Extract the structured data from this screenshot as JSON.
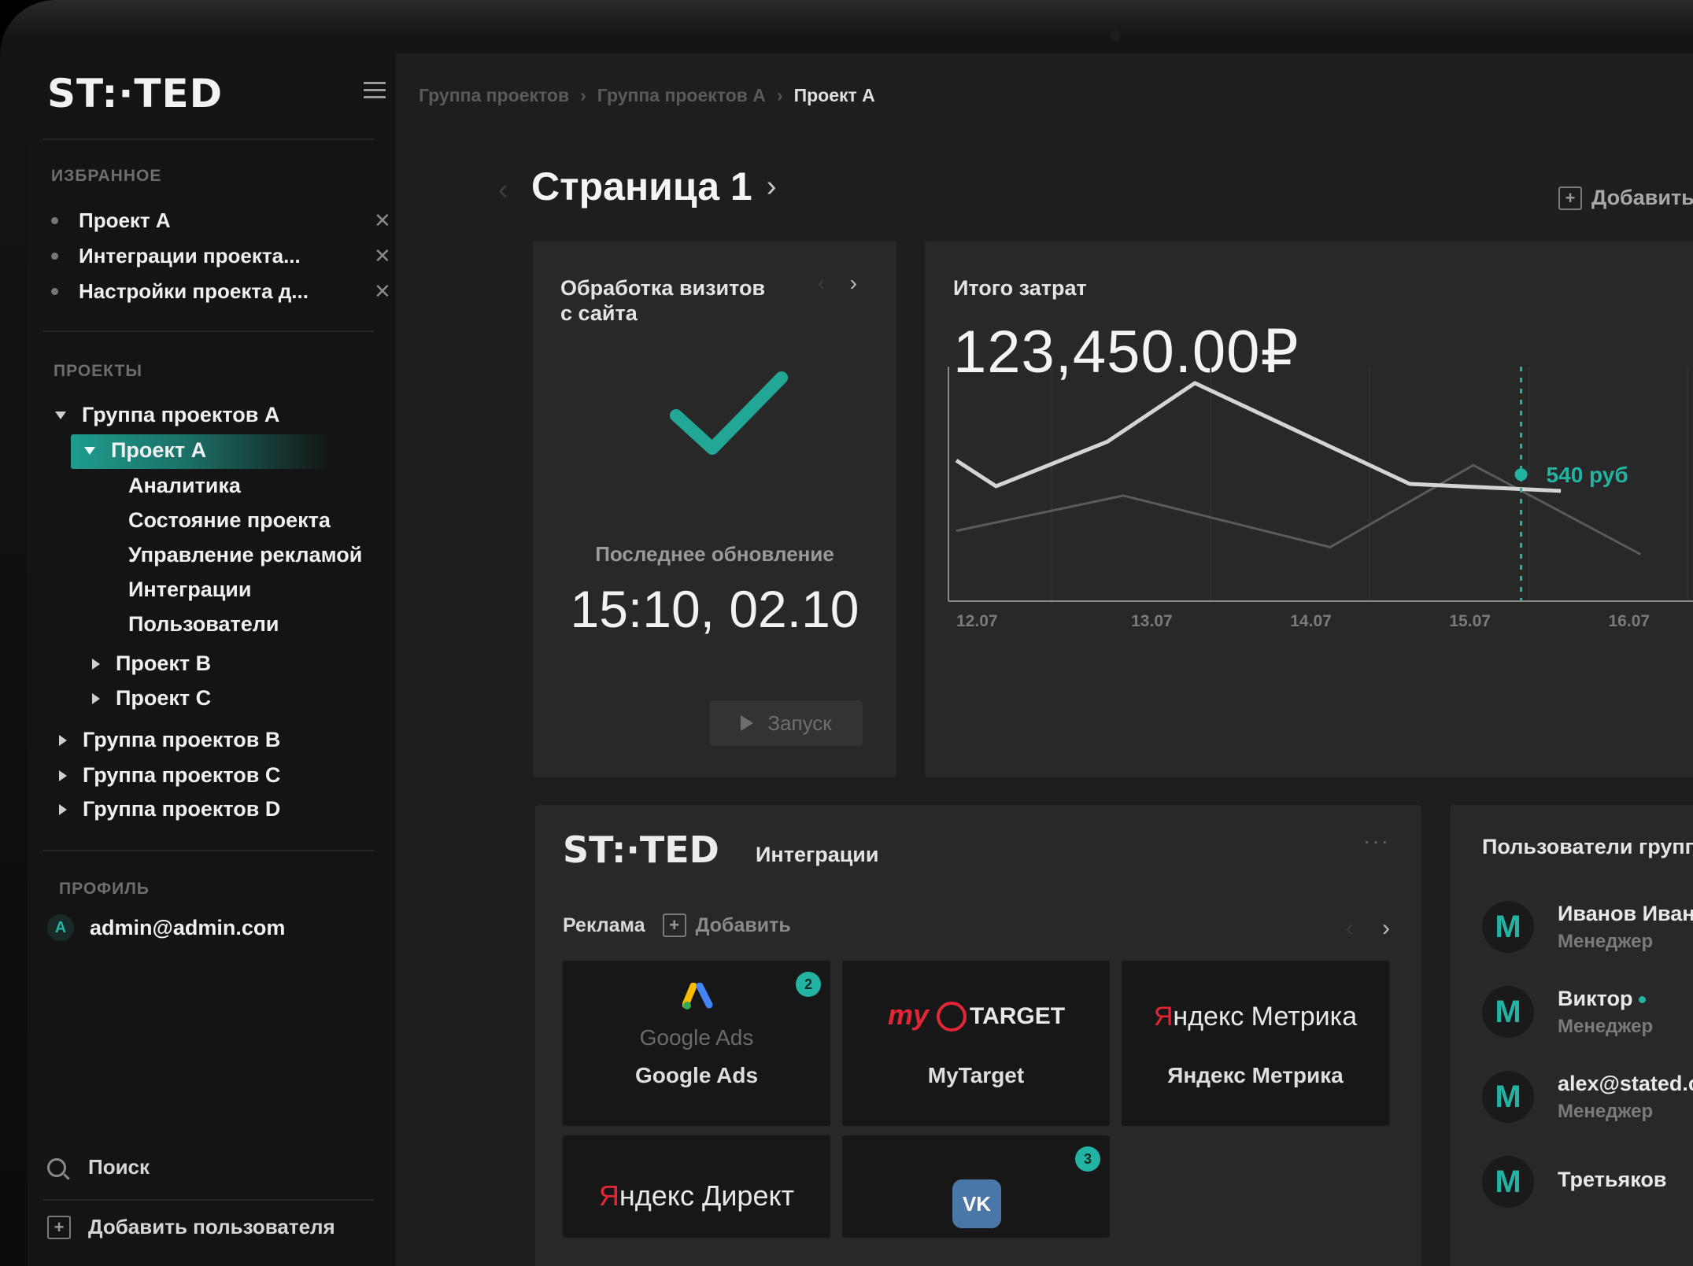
{
  "sidebar": {
    "logo": "ST:·TED",
    "favorites_title": "ИЗБРАННОЕ",
    "favorites": [
      "Проект А",
      "Интеграции проекта...",
      "Настройки проекта д..."
    ],
    "projects_title": "ПРОЕКТЫ",
    "tree": {
      "group_a": "Группа проектов А",
      "project_a": "Проект А",
      "project_a_children": [
        "Аналитика",
        "Состояние проекта",
        "Управление рекламой",
        "Интеграции",
        "Пользователи"
      ],
      "project_b": "Проект В",
      "project_c": "Проект С",
      "group_b": "Группа проектов В",
      "group_c": "Группа проектов С",
      "group_d": "Группа проектов D"
    },
    "profile_title": "ПРОФИЛЬ",
    "profile_avatar": "A",
    "profile_email": "admin@admin.com",
    "search_label": "Поиск",
    "add_user_label": "Добавить пользователя"
  },
  "breadcrumb": [
    "Группа проектов",
    "Группа проектов А",
    "Проект А"
  ],
  "page": {
    "title": "Страница 1",
    "add_label": "Добавить"
  },
  "visits_card": {
    "title_line1": "Обработка визитов",
    "title_line2": "с сайта",
    "last_update_label": "Последнее обновление",
    "last_update_value": "15:10, 02.10",
    "run_label": "Запуск"
  },
  "costs_card": {
    "title": "Итого затрат",
    "total": "123,450.00₽",
    "tooltip": "540 руб"
  },
  "chart_data": {
    "type": "line",
    "categories": [
      "12.07",
      "13.07",
      "14.07",
      "15.07",
      "16.07"
    ],
    "series": [
      {
        "name": "",
        "points": [
          [
            0.0,
            600
          ],
          [
            0.25,
            490
          ],
          [
            0.95,
            680
          ],
          [
            1.5,
            930
          ],
          [
            2.85,
            500
          ],
          [
            3.8,
            470
          ]
        ]
      },
      {
        "name": "",
        "points": [
          [
            0.0,
            300
          ],
          [
            1.05,
            450
          ],
          [
            2.35,
            230
          ],
          [
            3.25,
            580
          ],
          [
            4.3,
            200
          ]
        ]
      }
    ],
    "highlight": {
      "x": 3.55,
      "value": 540,
      "label": "540 руб"
    },
    "ylim": [
      0,
      1000
    ],
    "xlim": [
      0,
      4.7
    ],
    "grid": true,
    "line_colors": [
      "#d4d4d4",
      "#5a5a5a"
    ],
    "accent": "#22b3a3"
  },
  "integrations": {
    "logo": "ST:·TED",
    "title": "Интеграции",
    "more": "···",
    "section": "Реклама",
    "add_label": "Добавить",
    "tiles": [
      {
        "name": "Google Ads",
        "brand": "Google Ads",
        "badge": "2"
      },
      {
        "name": "MyTarget",
        "brand_left": "my",
        "brand_right": "TARGET",
        "badge": ""
      },
      {
        "name": "Яндекс Метрика",
        "brand_left": "Я",
        "brand_right": "ндекс Метрика",
        "badge": ""
      },
      {
        "name": "",
        "brand_left": "Я",
        "brand_right": "ндекс Директ",
        "badge": ""
      },
      {
        "name": "",
        "brand": "VK",
        "badge": "3"
      }
    ]
  },
  "users": {
    "title": "Пользователи групп",
    "list": [
      {
        "avatar": "M",
        "name": "Иванов Иван",
        "role": "Менеджер"
      },
      {
        "avatar": "M",
        "name": "Виктор",
        "role": "Менеджер"
      },
      {
        "avatar": "M",
        "name": "alex@stated.c",
        "role": "Менеджер"
      },
      {
        "avatar": "M",
        "name": "Третьяков",
        "role": ""
      }
    ]
  },
  "colors": {
    "accent": "#22b3a3",
    "brand_red": "#e32636"
  }
}
